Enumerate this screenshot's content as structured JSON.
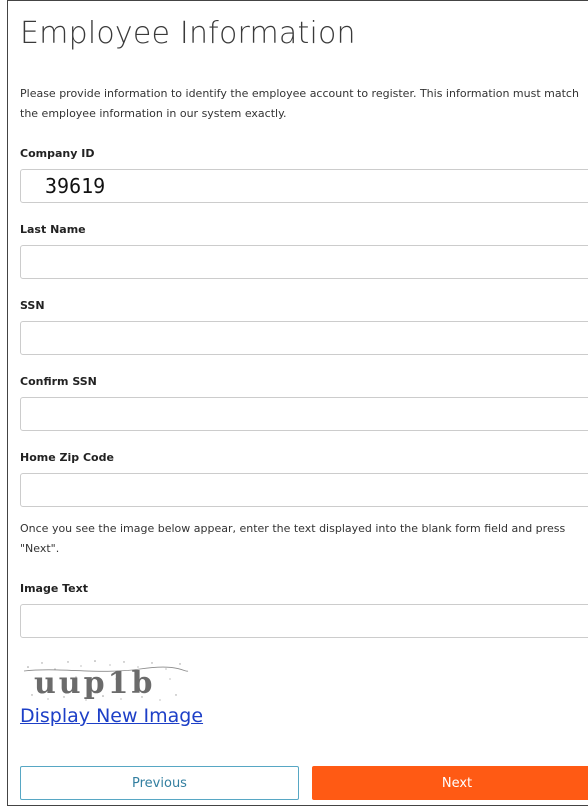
{
  "page": {
    "title": "Employee Information",
    "intro": "Please provide information to identify the employee account to register. This information must match the employee information in our system exactly."
  },
  "fields": {
    "company_id": {
      "label": "Company ID",
      "value": "39619"
    },
    "last_name": {
      "label": "Last Name",
      "value": ""
    },
    "ssn": {
      "label": "SSN",
      "value": ""
    },
    "confirm_ssn": {
      "label": "Confirm SSN",
      "value": ""
    },
    "home_zip": {
      "label": "Home Zip Code",
      "value": ""
    }
  },
  "captcha": {
    "instructions": "Once you see the image below appear, enter the text displayed into the blank form field and press \"Next\".",
    "image_text_label": "Image Text",
    "image_text_value": "",
    "captcha_text": "uup1b",
    "display_new_image": "Display New Image"
  },
  "buttons": {
    "previous": "Previous",
    "next": "Next"
  },
  "colors": {
    "next_bg": "#ff5a14",
    "previous_border": "#57a7c4",
    "link": "#1d3fc7"
  }
}
